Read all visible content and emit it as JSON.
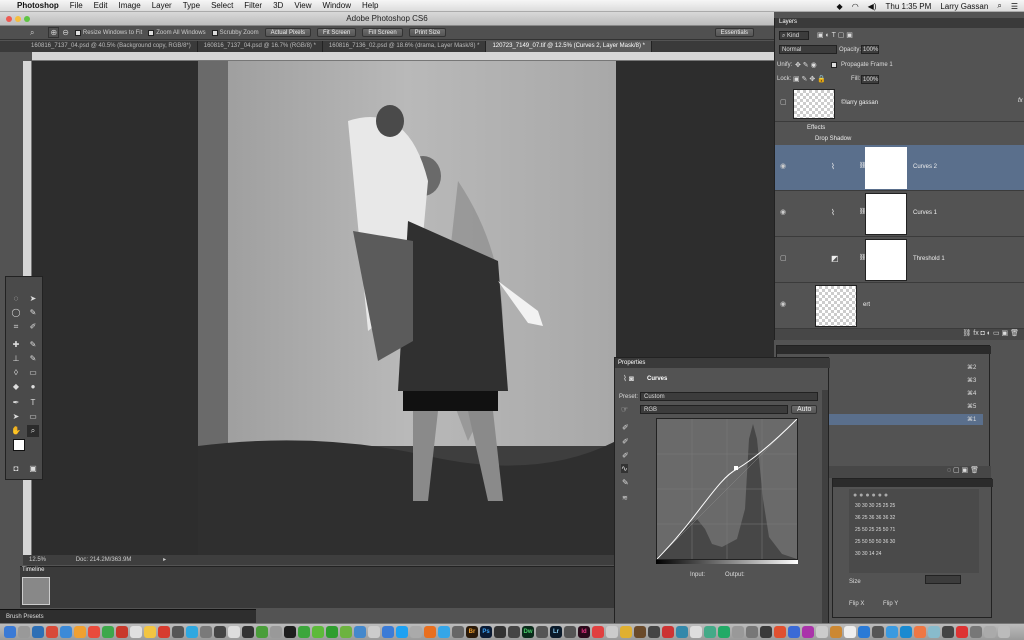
{
  "menubar": {
    "app": "Photoshop",
    "items": [
      "File",
      "Edit",
      "Image",
      "Layer",
      "Type",
      "Select",
      "Filter",
      "3D",
      "View",
      "Window",
      "Help"
    ],
    "clock": "Thu 1:35 PM",
    "user": "Larry Gassan"
  },
  "window": {
    "title": "Adobe Photoshop CS6"
  },
  "options": {
    "resize_windows": "Resize Windows to Fit",
    "zoom_all": "Zoom All Windows",
    "scrubby": "Scrubby Zoom",
    "actual_pixels": "Actual Pixels",
    "fit_screen": "Fit Screen",
    "fill_screen": "Fill Screen",
    "print_size": "Print Size",
    "workspace": "Essentials"
  },
  "tabs": [
    "160816_7137_04.psd @ 40.5% (Background copy, RGB/8*)",
    "160816_7137_04.psd @ 16.7% (RGB/8) *",
    "160816_7136_02.psd @ 18.6% (drama, Layer Mask/8) *",
    "120723_7149_07.tif @ 12.5% (Curves 2, Layer Mask/8) *"
  ],
  "status": {
    "zoom": "12.5%",
    "doc": "Doc: 214.2M/363.9M"
  },
  "timeline": {
    "label": "Timeline"
  },
  "brush_presets": {
    "label": "Brush Presets"
  },
  "layers": {
    "title": "Layers",
    "kind": "Kind",
    "blend_mode": "Normal",
    "opacity_label": "Opacity:",
    "opacity": "100%",
    "unify_label": "Unify:",
    "propagate": "Propagate Frame 1",
    "lock_label": "Lock:",
    "fill_label": "Fill:",
    "fill": "100%",
    "items": [
      {
        "name": "©larry gassan",
        "type": "text"
      },
      {
        "name": "Effects",
        "type": "effect"
      },
      {
        "name": "Drop Shadow",
        "type": "effect"
      },
      {
        "name": "Curves 2",
        "type": "adjustment",
        "selected": true
      },
      {
        "name": "Curves 1",
        "type": "adjustment"
      },
      {
        "name": "Threshold 1",
        "type": "adjustment"
      },
      {
        "name": "ert",
        "type": "pixel"
      }
    ]
  },
  "properties": {
    "title": "Properties",
    "panel_name": "Curves",
    "preset_label": "Preset:",
    "preset": "Custom",
    "channel": "RGB",
    "auto": "Auto",
    "input_label": "Input:",
    "output_label": "Output:"
  },
  "shortcuts": [
    "⌘2",
    "⌘3",
    "⌘4",
    "⌘5",
    "⌘1"
  ],
  "brushes": {
    "sizes": [
      "30",
      "30",
      "30",
      "25",
      "25",
      "25",
      "36",
      "25",
      "36",
      "36",
      "36",
      "32",
      "25",
      "50",
      "25",
      "25",
      "50",
      "71",
      "25",
      "50",
      "50",
      "50",
      "36",
      "30",
      "30",
      "30",
      "14",
      "24"
    ],
    "size_label": "Size",
    "flip_x": "Flip X",
    "flip_y": "Flip Y"
  },
  "colors": {
    "accent_selected": "#5a6f8c",
    "panel": "#535353",
    "canvas_bg": "#2d2d2d"
  }
}
